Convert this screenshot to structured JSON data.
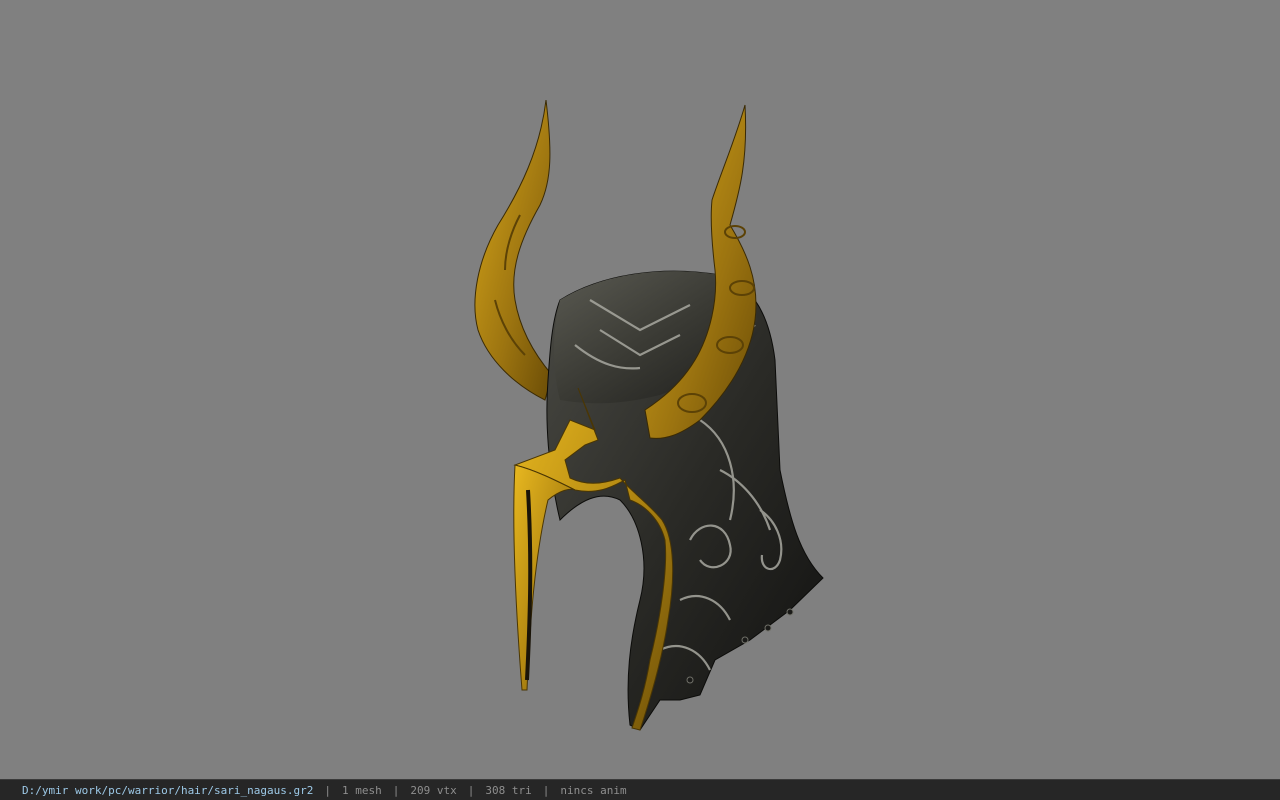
{
  "viewer": {
    "background_color": "#808080",
    "model_icon": "horned-helmet-model"
  },
  "status": {
    "file_path": "D:/ymir work/pc/warrior/hair/sari_nagaus.gr2",
    "separator": "|",
    "mesh_count": "1 mesh",
    "vertex_count": "209 vtx",
    "triangle_count": "308 tri",
    "animation": "nincs anim",
    "path_color": "#9cc8e6",
    "text_color": "#8e8e8e"
  }
}
